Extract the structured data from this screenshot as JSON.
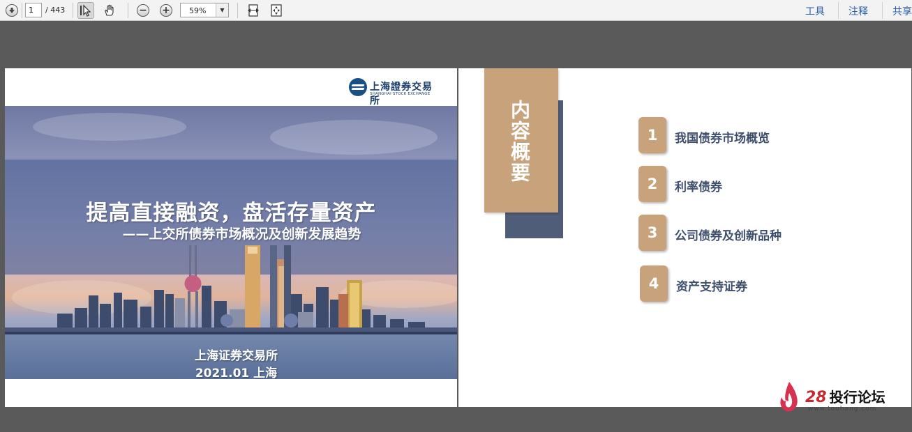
{
  "toolbar": {
    "page_current": "1",
    "page_total": "/ 443",
    "zoom": "59%",
    "links": [
      "工具",
      "注释",
      "共享"
    ]
  },
  "slide1": {
    "logo_cn": "上海證券交易所",
    "logo_en": "SHANGHAI STOCK EXCHANGE",
    "title": "提高直接融资，盘活存量资产",
    "subtitle": "——上交所债券市场概况及创新发展趋势",
    "org": "上海证券交易所",
    "date": "2021.01  上海"
  },
  "slide2": {
    "toc_title": "内容概要",
    "items": [
      {
        "num": "1",
        "label": "我国债券市场概览"
      },
      {
        "num": "2",
        "label": "利率债券"
      },
      {
        "num": "3",
        "label": "公司债券及创新品种"
      },
      {
        "num": "4",
        "label": "资产支持证券"
      }
    ]
  },
  "watermark": {
    "brand": "28",
    "name": "投行论坛",
    "url": "www.touhang.com"
  },
  "colors": {
    "accent_tan": "#c8a27b",
    "navy": "#4f5d78",
    "link_blue": "#2b5fae"
  }
}
